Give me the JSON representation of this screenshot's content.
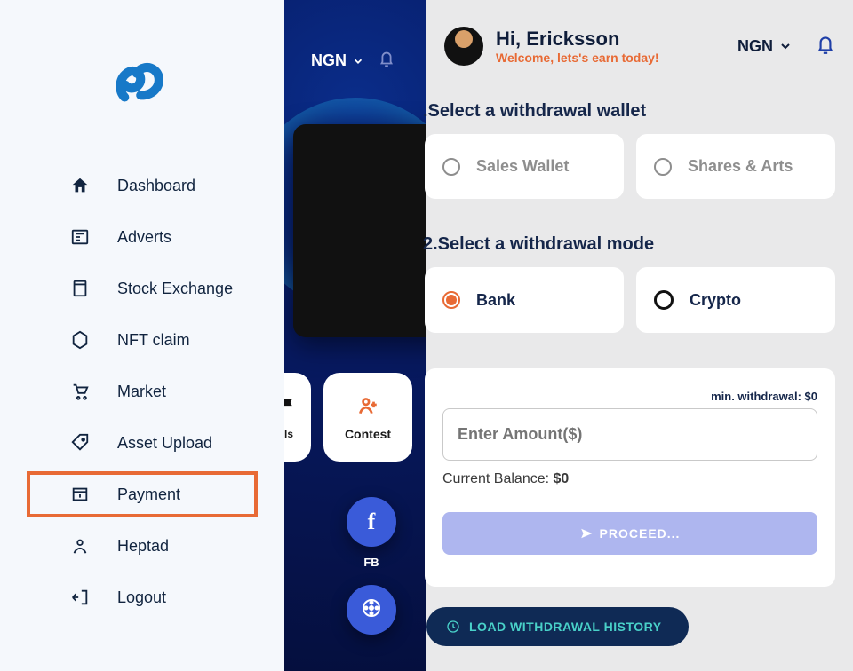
{
  "sidebar": {
    "items": [
      {
        "label": "Dashboard"
      },
      {
        "label": "Adverts"
      },
      {
        "label": "Stock Exchange"
      },
      {
        "label": "NFT claim"
      },
      {
        "label": "Market"
      },
      {
        "label": "Asset Upload"
      },
      {
        "label": "Payment"
      },
      {
        "label": "Heptad"
      },
      {
        "label": "Logout"
      }
    ]
  },
  "mid": {
    "currency": "NGN",
    "contest_label": "Contest",
    "fb_label": "FB"
  },
  "header": {
    "greeting": "Hi, Ericksson",
    "welcome": "Welcome, lets's earn today!",
    "currency": "NGN"
  },
  "withdraw": {
    "section1_title": ".Select a withdrawal wallet",
    "wallet_options": [
      {
        "label": "Sales Wallet"
      },
      {
        "label": "Shares & Arts"
      }
    ],
    "section2_title": "2.Select a withdrawal mode",
    "mode_options": [
      {
        "label": "Bank"
      },
      {
        "label": "Crypto"
      }
    ],
    "min_label": "min. withdrawal: $0",
    "amount_placeholder": "Enter Amount($)",
    "current_balance_label": "Current Balance: ",
    "current_balance_value": "$0",
    "proceed_label": "PROCEED...",
    "history_label": "LOAD WITHDRAWAL HISTORY"
  }
}
